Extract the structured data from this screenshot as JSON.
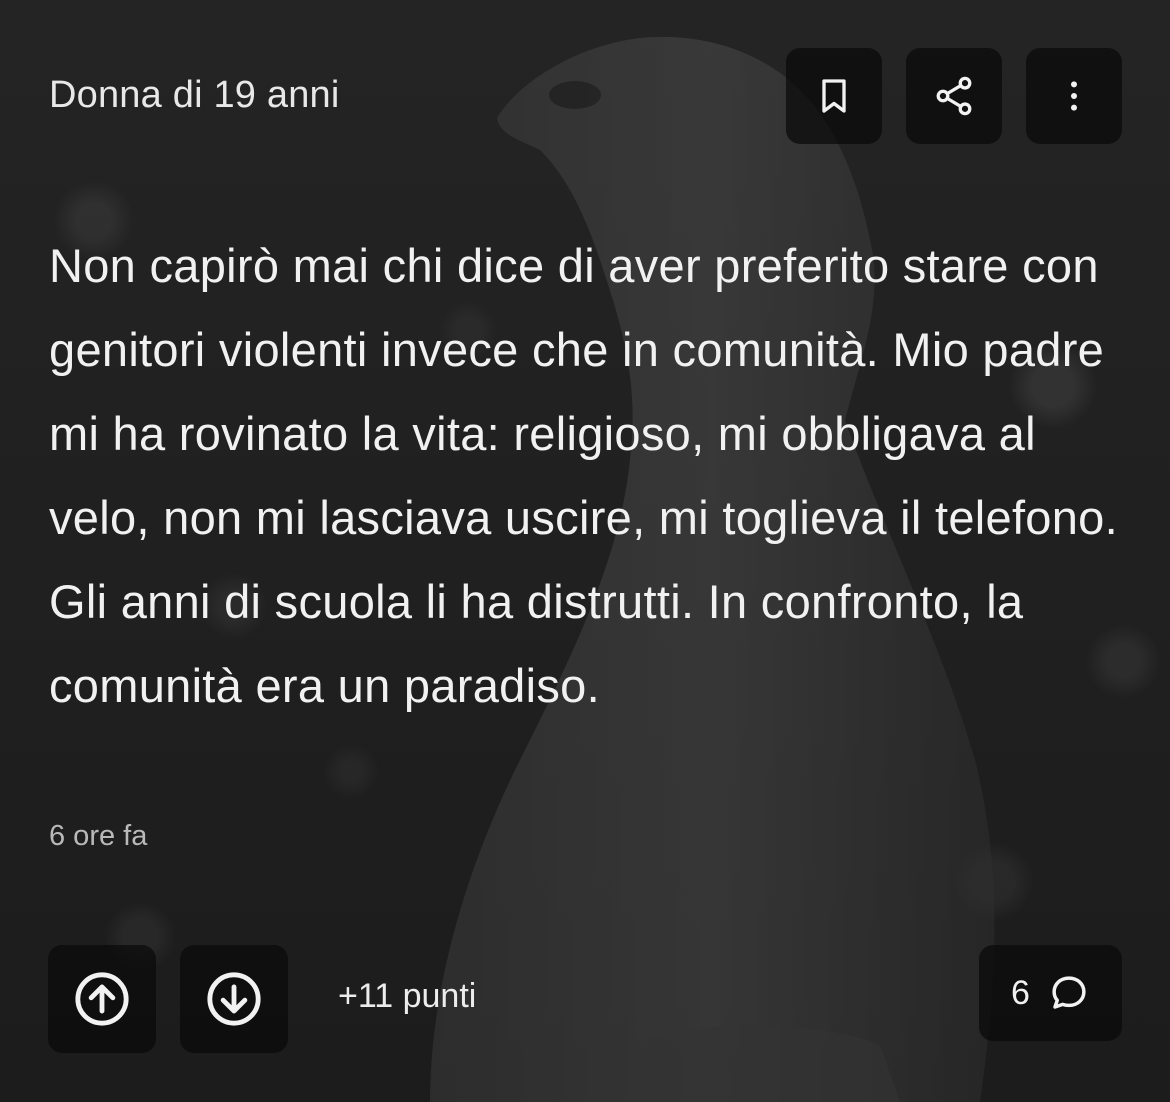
{
  "post": {
    "author_label": "Donna di 19 anni",
    "text": "Non capirò mai chi dice di aver preferito stare con genitori violenti invece che in comunità. Mio padre mi ha rovinato la vita: religioso, mi obbligava al velo, non mi lasciava uscire, mi toglieva il telefono. Gli anni di scuola li ha distrutti. In confronto, la comunità era un paradiso.",
    "timestamp": "6 ore fa"
  },
  "actions": {
    "bookmark_icon": "bookmark-icon",
    "share_icon": "share-icon",
    "more_icon": "more-vertical-icon"
  },
  "footer": {
    "upvote_icon": "arrow-up-circle-icon",
    "downvote_icon": "arrow-down-circle-icon",
    "points_label": "+11 punti",
    "comments_count": "6",
    "comment_icon": "comment-bubble-icon"
  },
  "colors": {
    "background": "#1e1e1e",
    "button_bg": "#0a0a0a",
    "text_primary": "#f1f1f1",
    "text_muted": "#b9b9b9"
  }
}
